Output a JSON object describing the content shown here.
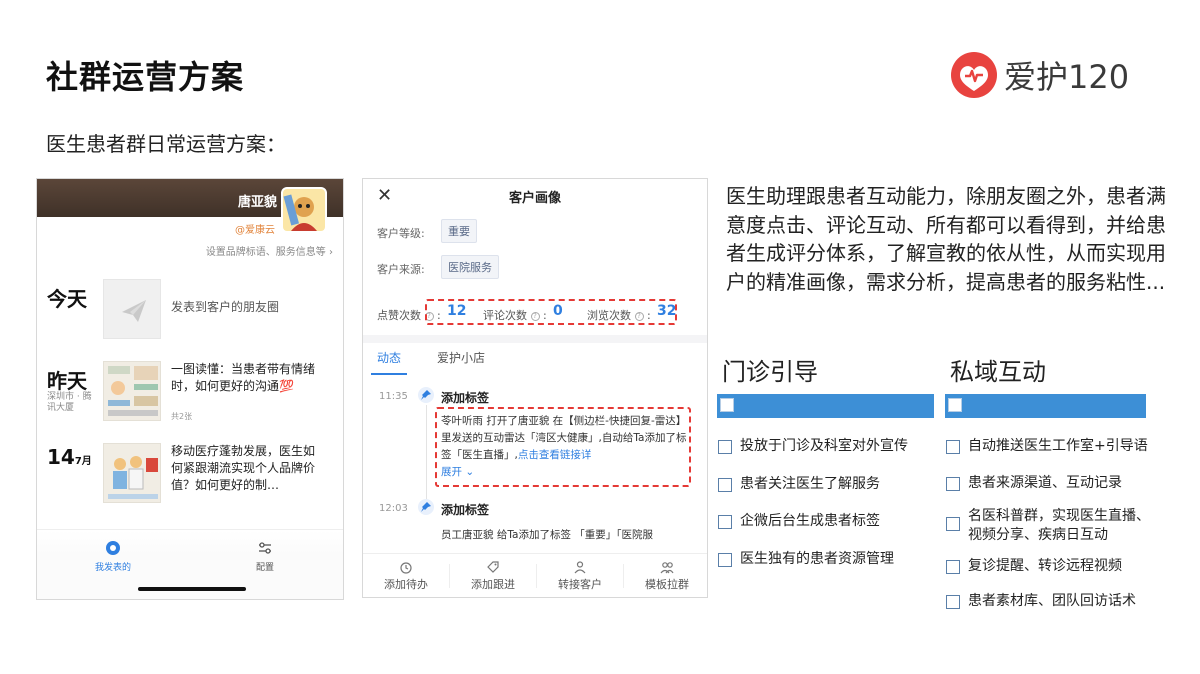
{
  "slide": {
    "title": "社群运营方案",
    "subtitle": "医生患者群日常运营方案：",
    "logo_text": "爱护120"
  },
  "moments_screen": {
    "profile_name": "唐亚貌",
    "profile_handle": "@爱康云",
    "settings_link": "设置品牌标语、服务信息等 ›",
    "today_label": "今天",
    "today_prompt": "发表到客户的朋友圈",
    "yesterday_label": "昨天",
    "yesterday_location": "深圳市 · 腾讯大厦",
    "yesterday_post": "一图读懂：当患者带有情绪时，如何更好的沟通💯",
    "yesterday_count": "共2张",
    "date_day": "14",
    "date_month": "7月",
    "date_post": "移动医疗蓬勃发展，医生如何紧跟潮流实现个人品牌价值？如何更好的制…",
    "tab_mine": "我发表的",
    "tab_config": "配置",
    "accent_color": "#2f7fe0"
  },
  "profile_screen": {
    "title": "客户画像",
    "level_label": "客户等级:",
    "level_value": "重要",
    "source_label": "客户来源:",
    "source_value": "医院服务",
    "likes_label": "点赞次数",
    "likes_value": "12",
    "comments_label": "评论次数",
    "comments_value": "0",
    "views_label": "浏览次数",
    "views_value": "32",
    "tab_activity": "动态",
    "tab_shop": "爱护小店",
    "entry1_time": "11:35",
    "entry1_title": "添加标签",
    "entry1_body": "苓叶听雨 打开了唐亚貌 在【侧边栏-快捷回复-雷达】里发送的互动雷达「湾区大健康」,自动给Ta添加了标签「医生直播」,",
    "entry1_link": "点击查看链接详",
    "entry1_expand": "展开 ⌄",
    "entry2_time": "12:03",
    "entry2_title": "添加标签",
    "entry2_body": "员工唐亚貌 给Ta添加了标签 「重要」「医院服",
    "bottom_todo": "添加待办",
    "bottom_follow": "添加跟进",
    "bottom_transfer": "转接客户",
    "bottom_group": "模板拉群"
  },
  "description": "医生助理跟患者互动能力，除朋友圈之外，患者满意度点击、评论互动、所有都可以看得到，并给患者生成评分体系，了解宣教的依从性，从而实现用户的精准画像，需求分析，提高患者的服务粘性...",
  "clinic_section": {
    "title": "门诊引导",
    "items": [
      "投放于门诊及科室对外宣传",
      "患者关注医生了解服务",
      "企微后台生成患者标签",
      "医生独有的患者资源管理"
    ]
  },
  "private_section": {
    "title": "私域互动",
    "items": [
      "自动推送医生工作室+引导语",
      "患者来源渠道、互动记录",
      "名医科普群，实现医生直播、视频分享、疾病日互动",
      "复诊提醒、转诊远程视频",
      "患者素材库、团队回访话术"
    ]
  },
  "colors": {
    "section_bar": "#3d8fd6",
    "highlight_dash": "#e53935",
    "logo_red": "#e8433f"
  }
}
